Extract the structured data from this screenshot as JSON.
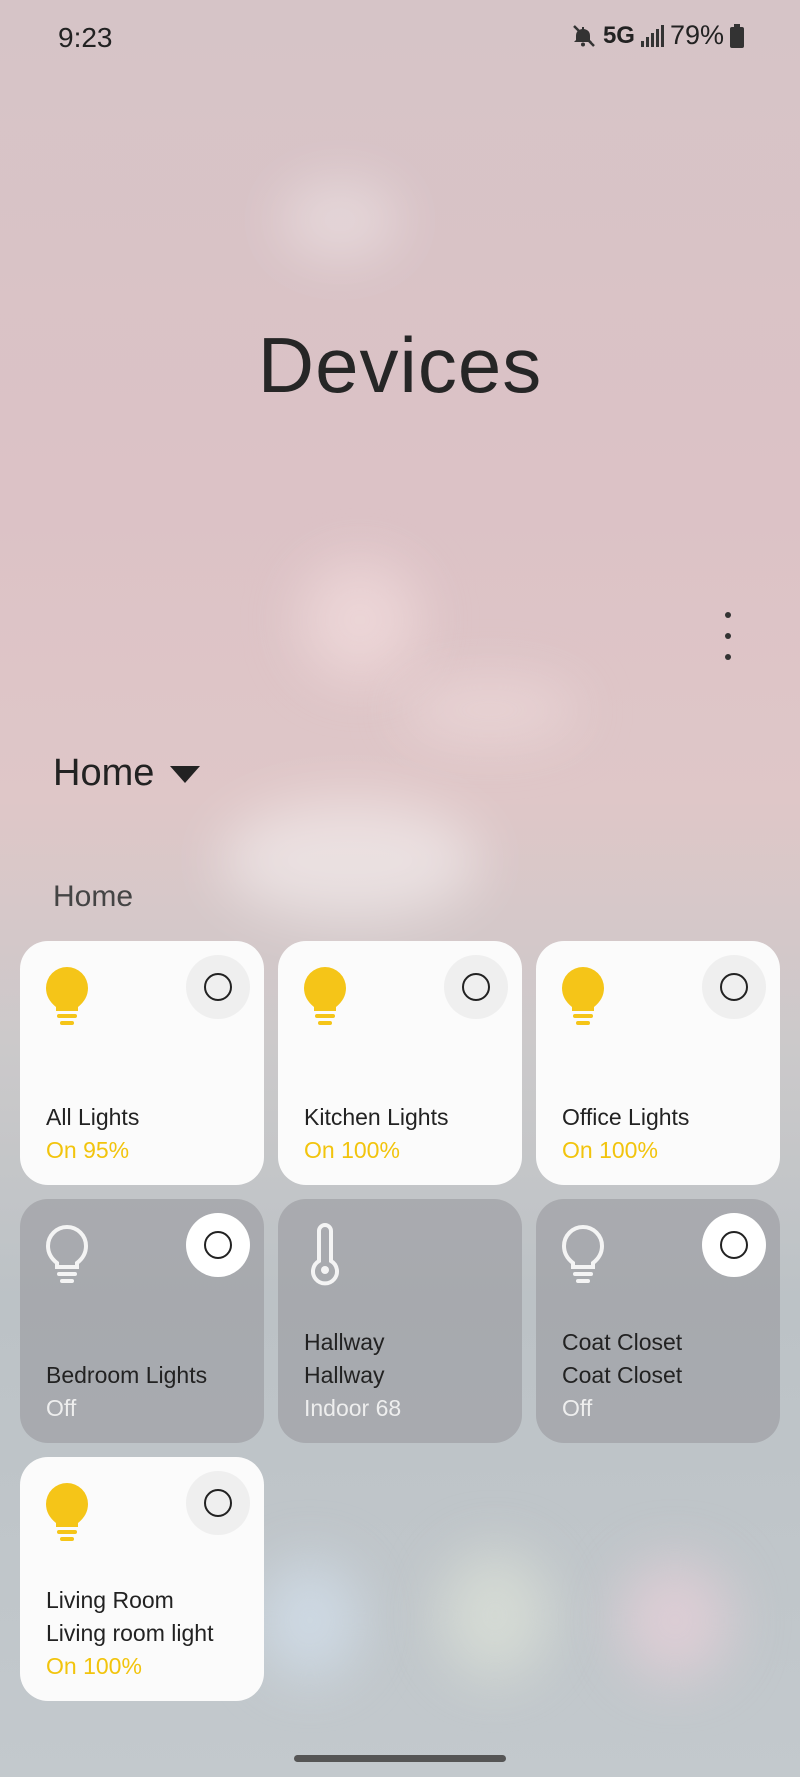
{
  "status_bar": {
    "time": "9:23",
    "network": "5G",
    "battery": "79%"
  },
  "page": {
    "title": "Devices"
  },
  "location_selector": {
    "label": "Home"
  },
  "section": {
    "label": "Home"
  },
  "colors": {
    "accent_on": "#f2c40d",
    "tile_on_bg": "#fbfbfb",
    "tile_off_bg": "rgba(150,150,155,0.55)"
  },
  "devices": [
    {
      "name": "All Lights",
      "name2": "",
      "status": "On 95%",
      "icon": "lightbulb-icon",
      "on": true
    },
    {
      "name": "Kitchen Lights",
      "name2": "",
      "status": "On 100%",
      "icon": "lightbulb-icon",
      "on": true
    },
    {
      "name": "Office Lights",
      "name2": "",
      "status": "On 100%",
      "icon": "lightbulb-icon",
      "on": true
    },
    {
      "name": "Bedroom Lights",
      "name2": "",
      "status": "Off",
      "icon": "lightbulb-outline-icon",
      "on": false
    },
    {
      "name": "Hallway",
      "name2": "Hallway",
      "status": "Indoor 68",
      "icon": "thermometer-icon",
      "on": false
    },
    {
      "name": "Coat Closet",
      "name2": "Coat Closet",
      "status": "Off",
      "icon": "lightbulb-outline-icon",
      "on": false
    },
    {
      "name": "Living Room",
      "name2": "Living room light",
      "status": "On 100%",
      "icon": "lightbulb-icon",
      "on": true
    }
  ]
}
